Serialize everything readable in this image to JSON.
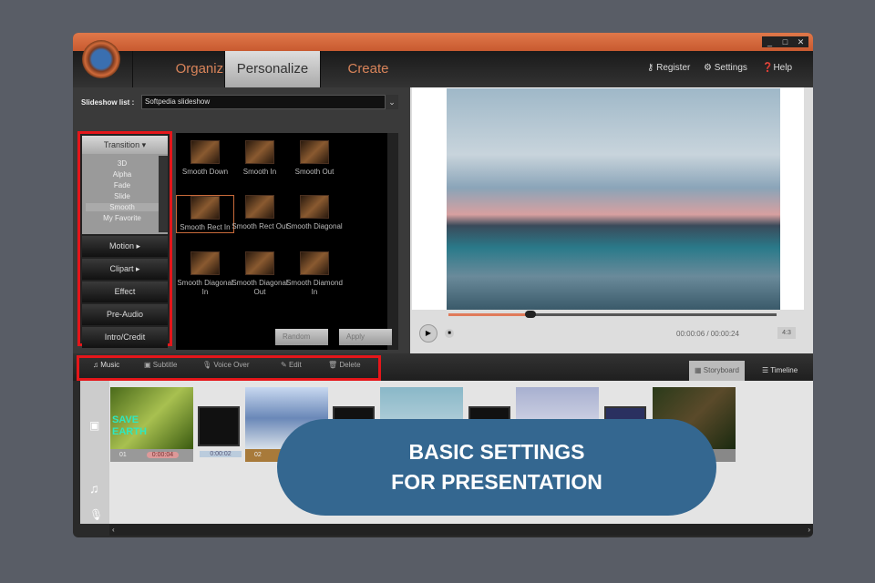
{
  "window": {
    "controls": [
      "_",
      "□",
      "✕"
    ]
  },
  "nav": {
    "tabs": [
      "Organize",
      "Personalize",
      "Create"
    ],
    "active": "Personalize",
    "links": {
      "register": "Register",
      "settings": "Settings",
      "help": "Help"
    }
  },
  "slideshow": {
    "label": "Slideshow list :",
    "value": "Softpedia slideshow"
  },
  "categories": {
    "transition": "Transition",
    "sub": [
      "3D",
      "Alpha",
      "Fade",
      "Slide",
      "Smooth",
      "My Favorite"
    ],
    "selected_sub": "Smooth",
    "items": [
      "Motion",
      "Clipart",
      "Effect",
      "Pre-Audio",
      "Intro/Credit"
    ]
  },
  "effects": [
    "Smooth Down",
    "Smooth In",
    "Smooth Out",
    "Smooth Rect In",
    "Smooth Rect Out",
    "Smooth Diagonal",
    "Smooth Diagonal In",
    "Smooth Diagonal Out",
    "Smooth Diamond In"
  ],
  "effects_selected": "Smooth Rect In",
  "buttons": {
    "random": "Random",
    "apply": "Apply"
  },
  "player": {
    "time": "00:00:06 / 00:00:24",
    "progress": 0.25,
    "ratio": "4:3"
  },
  "toolbar": {
    "music": "Music",
    "subtitle": "Subtitle",
    "voice_over": "Voice Over",
    "edit": "Edit",
    "delete": "Delete",
    "storyboard": "Storyboard",
    "timeline": "Timeline"
  },
  "clips": [
    {
      "num": "01",
      "dur": "0:00:04",
      "caption": "SAVE EARTH"
    },
    {
      "num": "02"
    },
    {},
    {},
    {}
  ],
  "transitions": [
    {
      "dur": "0:00:02"
    },
    {},
    {},
    {}
  ],
  "overlay": {
    "line1": "BASIC SETTINGS",
    "line2": "FOR PRESENTATION"
  },
  "colors": {
    "highlight": "#e5161a",
    "pill": "#346790",
    "titlebar": "#d06a3a"
  }
}
